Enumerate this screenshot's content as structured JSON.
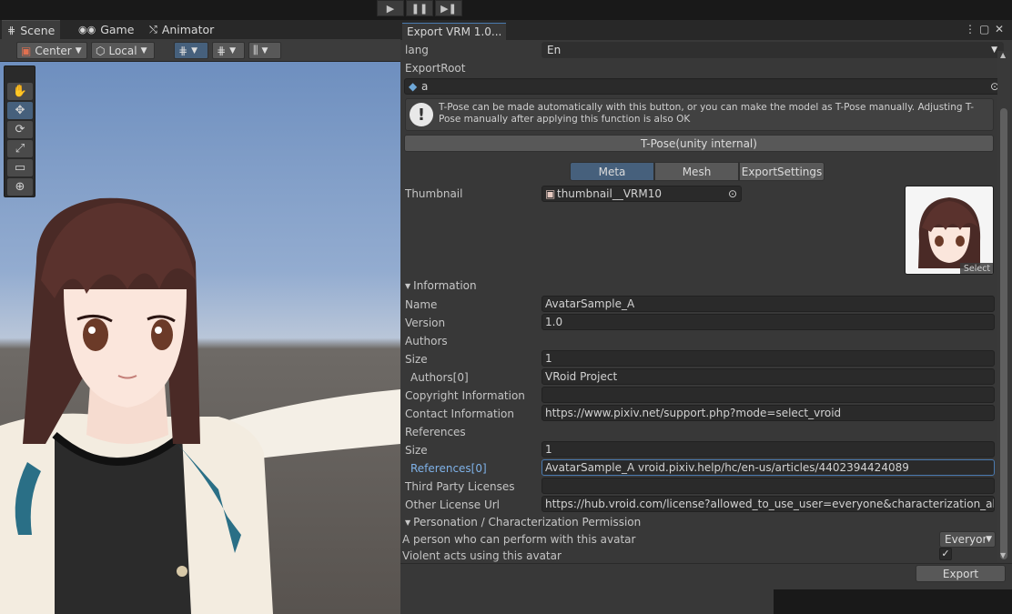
{
  "playbar": {
    "play_icon": "play-icon",
    "pause_icon": "pause-icon",
    "step_icon": "step-icon"
  },
  "scene_window": {
    "tabs": [
      {
        "label": "Scene",
        "icon": "grid-icon"
      },
      {
        "label": "Game",
        "icon": "gamepad-icon"
      },
      {
        "label": "Animator",
        "icon": "animator-icon"
      }
    ],
    "toolbar": {
      "pivot_label": "Center",
      "space_label": "Local"
    },
    "tools": [
      "hand-icon",
      "move-icon",
      "rotate-icon",
      "scale-icon",
      "rect-icon",
      "transform-icon"
    ]
  },
  "export_window": {
    "title": "Export VRM 1.0...",
    "lang_label": "lang",
    "lang_value": "En",
    "export_root_label": "ExportRoot",
    "export_root_value": "a",
    "help_text": "T-Pose can be made automatically with this button, or you can make the model as T-Pose manually. Adjusting T-Pose manually after applying this function is also OK",
    "tpose_button": "T-Pose(unity internal)",
    "tabs": [
      "Meta",
      "Mesh",
      "ExportSettings"
    ],
    "active_tab": "Meta",
    "thumbnail_label": "Thumbnail",
    "thumbnail_value": "thumbnail__VRM10",
    "thumbnail_select": "Select",
    "information_header": "Information",
    "fields": {
      "name_label": "Name",
      "name_value": "AvatarSample_A",
      "version_label": "Version",
      "version_value": "1.0",
      "authors_label": "Authors",
      "authors_size_label": "Size",
      "authors_size_value": "1",
      "authors0_label": "Authors[0]",
      "authors0_value": "VRoid Project",
      "copyright_label": "Copyright Information",
      "copyright_value": "",
      "contact_label": "Contact Information",
      "contact_value": "https://www.pixiv.net/support.php?mode=select_vroid",
      "references_label": "References",
      "references_size_label": "Size",
      "references_size_value": "1",
      "references0_label": "References[0]",
      "references0_value": "AvatarSample_A vroid.pixiv.help/hc/en-us/articles/4402394424089",
      "third_party_label": "Third Party Licenses",
      "third_party_value": "",
      "other_license_label": "Other License Url",
      "other_license_value": "https://hub.vroid.com/license?allowed_to_use_user=everyone&characterization_allowed"
    },
    "permission_header": "Personation / Characterization Permission",
    "perform_label": "A person who can perform with this avatar",
    "perform_value": "Everyor",
    "violent_label": "Violent acts using this avatar",
    "export_button": "Export"
  },
  "colors": {
    "accent": "#46607c",
    "focus": "#4a7ab0",
    "panel": "#383838"
  }
}
